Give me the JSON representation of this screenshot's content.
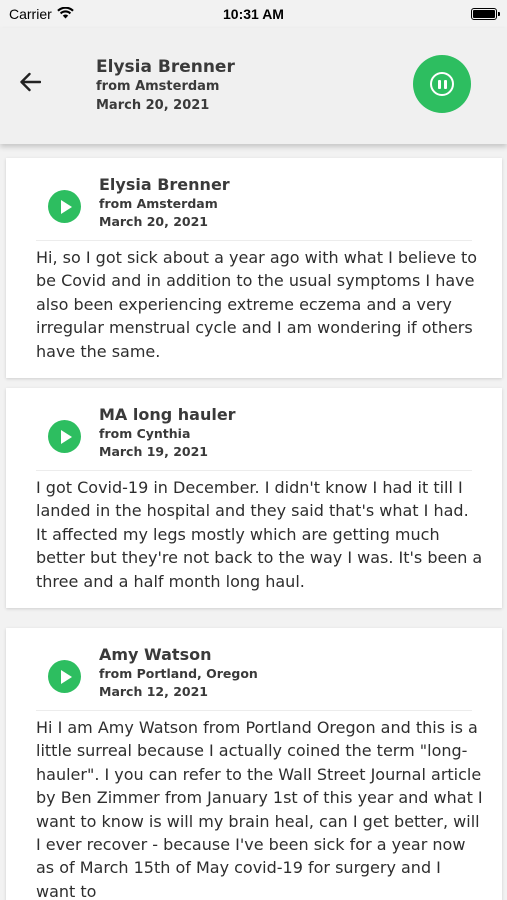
{
  "status_bar": {
    "carrier": "Carrier",
    "time": "10:31 AM"
  },
  "header": {
    "name": "Elysia Brenner",
    "location": "from Amsterdam",
    "date": "March 20, 2021"
  },
  "stories": [
    {
      "name": "Elysia Brenner",
      "location": "from Amsterdam",
      "date": "March 20, 2021",
      "text": "Hi, so I got sick about a year ago with what I believe to be Covid and in addition to the usual symptoms I have also been experiencing extreme eczema and a very irregular menstrual cycle and I am wondering if others have the same."
    },
    {
      "name": "MA long hauler",
      "location": "from Cynthia",
      "date": "March 19, 2021",
      "text": "I got Covid-19 in December. I didn't know I had it till I landed in the hospital and they said that's what I had. It affected my legs mostly which are getting much better but they're not back to the way I was. It's been a three and a half month long haul."
    },
    {
      "name": "Amy Watson",
      "location": "from Portland, Oregon",
      "date": "March 12, 2021",
      "text": "Hi I am Amy Watson from Portland Oregon and this is a little surreal because I actually coined the term \"long-hauler\".  I you can refer to the Wall Street Journal article by Ben Zimmer from January 1st of this year and what I want to know is will my brain heal, can I get better, will I ever recover - because I've been sick for a year now as of March 15th of May covid-19 for surgery and I want to"
    }
  ],
  "colors": {
    "accent": "#2dbe60",
    "background": "#f2f2f2"
  },
  "icons": {
    "back": "arrow-left-icon",
    "pause": "pause-icon",
    "play": "play-icon",
    "wifi": "wifi-icon",
    "battery": "battery-icon"
  }
}
